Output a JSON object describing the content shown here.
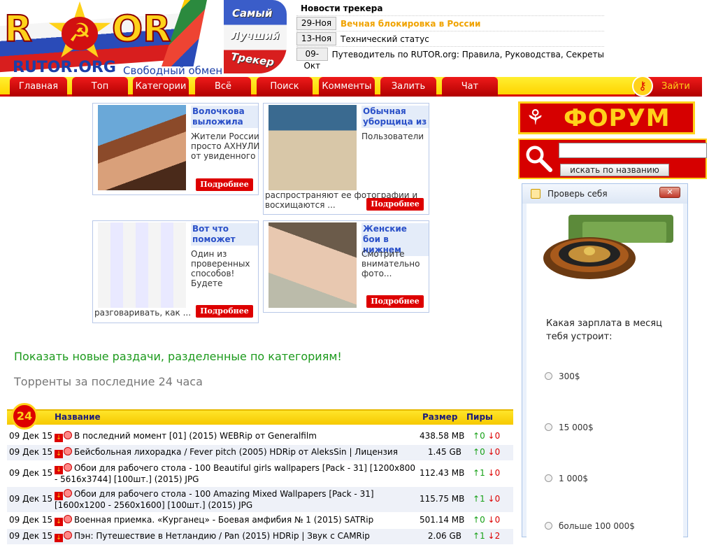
{
  "logo": {
    "letter_r": "R",
    "letters_or": "OR",
    "site": "RUTOR.ORG",
    "tagline": "Свободный обмен",
    "word1": "Самый",
    "word2": "Лучший",
    "word3": "Трекер"
  },
  "news": {
    "title": "Новости трекера",
    "items": [
      {
        "date": "29-Ноя",
        "text": "Вечная блокировка в России",
        "highlight": true
      },
      {
        "date": "13-Ноя",
        "text": "Технический статус",
        "highlight": false
      },
      {
        "date": "09-Окт",
        "text": "Путеводитель по RUTOR.org: Правила, Руководства, Секреты",
        "highlight": false
      }
    ]
  },
  "nav": {
    "tabs": [
      "Главная",
      "Топ",
      "Категории",
      "Всё",
      "Поиск",
      "Комменты",
      "Залить",
      "Чат"
    ],
    "login": "Зайти"
  },
  "ads": [
    {
      "title": "Волочкова выложила",
      "text": "Жители России просто АХНУЛИ от увиденного",
      "tail": "",
      "more": "Подробнее"
    },
    {
      "title": "Обычная уборщица из",
      "text": "Пользователи",
      "tail": "распространяют ее фотографии и восхищаются ...",
      "more": "Подробнее"
    },
    {
      "title": "Вот что поможет",
      "text": "Один из проверенных способов! Будете",
      "tail": "разговаривать, как ...",
      "more": "Подробнее"
    },
    {
      "title": "Женские бои в нижнем",
      "text": "Смотрите внимательно фото...",
      "tail": "",
      "more": "Подробнее"
    }
  ],
  "main": {
    "show_new_link": "Показать новые раздачи, разделенные по категориям!",
    "subtitle": "Торренты за последние 24 часа",
    "badge": "24"
  },
  "table": {
    "headers": {
      "name": "Название",
      "size": "Размер",
      "peers": "Пиры"
    },
    "rows": [
      {
        "date": "09 Дек 15",
        "name": "В последний момент [01] (2015) WEBRip от Generalfilm",
        "size": "438.58 MB",
        "up": "0",
        "down": "0"
      },
      {
        "date": "09 Дек 15",
        "name": "Бейсбольная лихорадка / Fever pitch (2005) HDRip от AleksSin | Лицензия",
        "size": "1.45 GB",
        "up": "0",
        "down": "0"
      },
      {
        "date": "09 Дек 15",
        "name": "Обои для рабочего стола - 100 Beautiful girls wallpapers [Pack - 31] [1200x800 - 5616x3744] [100шт.] (2015) JPG",
        "size": "112.43 MB",
        "up": "1",
        "down": "0"
      },
      {
        "date": "09 Дек 15",
        "name": "Обои для рабочего стола - 100 Amazing Mixed Wallpapers [Pack - 31] [1600x1200 - 2560x1600] [100шт.] (2015) JPG",
        "size": "115.75 MB",
        "up": "1",
        "down": "0"
      },
      {
        "date": "09 Дек 15",
        "name": "Военная приемка. «Курганец» - Боевая амфибия № 1 (2015) SATRip",
        "size": "501.14 MB",
        "up": "0",
        "down": "0"
      },
      {
        "date": "09 Дек 15",
        "name": "Пэн: Путешествие в Нетландию / Pan (2015) HDRip | Звук с CAMRip",
        "size": "2.06 GB",
        "up": "1",
        "down": "2"
      }
    ]
  },
  "sidebar": {
    "forum": "ФОРУМ",
    "search_button": "искать по названию",
    "search_value": "",
    "widget": {
      "title": "Проверь себя",
      "close": "✕",
      "question": "Какая зарплата в месяц тебя устроит:",
      "options": [
        "300$",
        "15 000$",
        "1 000$",
        "больше 100 000$"
      ]
    }
  },
  "colors": {
    "accent_red": "#d60000",
    "accent_yellow": "#ffd21a",
    "link_green": "#1c9a1c",
    "news_highlight": "#f0a300"
  }
}
